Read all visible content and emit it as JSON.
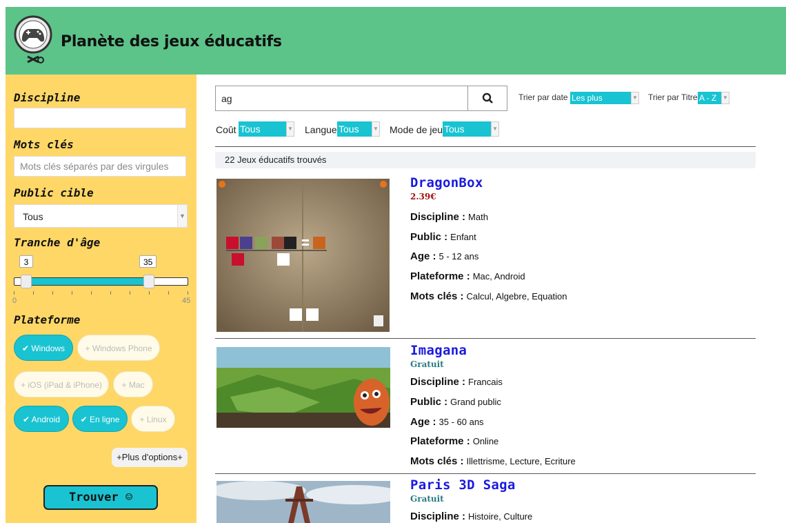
{
  "site": {
    "title": "Planète des jeux éducatifs"
  },
  "sidebar": {
    "discipline_label": "Discipline",
    "discipline_value": "",
    "keywords_label": "Mots clés",
    "keywords_placeholder": "Mots clés séparés par des virgules",
    "audience_label": "Public cible",
    "audience_value": "Tous",
    "age_label": "Tranche d'âge",
    "age_min_value": "3",
    "age_max_value": "35",
    "age_scale_min": "0",
    "age_scale_max": "45",
    "age_range": {
      "min": 3,
      "max": 35,
      "scale_min": 0,
      "scale_max": 45
    },
    "platform_label": "Plateforme",
    "platforms": [
      {
        "label": "Windows",
        "selected": true
      },
      {
        "label": "Windows Phone",
        "selected": false
      },
      {
        "label": "iOS (iPad & iPhone)",
        "selected": false
      },
      {
        "label": "Mac",
        "selected": false
      },
      {
        "label": "Android",
        "selected": true
      },
      {
        "label": "En ligne",
        "selected": true
      },
      {
        "label": "Linux",
        "selected": false
      }
    ],
    "more_options": "+Plus d'options+",
    "find_button": "Trouver ☺"
  },
  "search": {
    "query": "ag",
    "sort_date_label": "Trier par date",
    "sort_date_value": "Les plus récents",
    "sort_title_label": "Trier par Titre",
    "sort_title_value": "A - Z"
  },
  "filters": {
    "cost_label": "Coût",
    "cost_value": "Tous",
    "language_label": "Langue",
    "language_value": "Tous",
    "mode_label": "Mode de jeu",
    "mode_value": "Tous"
  },
  "results": {
    "count_text": "22 Jeux éducatifs trouvés",
    "attr_labels": {
      "discipline": "Discipline :",
      "public": "Public :",
      "age": "Age :",
      "platform": "Plateforme :",
      "keywords": "Mots clés :"
    },
    "games": [
      {
        "title": "DragonBox",
        "price": "2.39€",
        "discipline": "Math",
        "public": "Enfant",
        "age": "5 - 12 ans",
        "platform": "Mac, Android",
        "keywords": "Calcul, Algebre, Equation"
      },
      {
        "title": "Imagana",
        "price": "Gratuit",
        "discipline": "Francais",
        "public": "Grand public",
        "age": "35 - 60 ans",
        "platform": "Online",
        "keywords": "Illettrisme, Lecture, Ecriture"
      },
      {
        "title": "Paris 3D Saga",
        "price": "Gratuit",
        "discipline": "Histoire, Culture"
      }
    ]
  },
  "colors": {
    "header": "#5cc389",
    "sidebar": "#fed767",
    "accent": "#19c3d1",
    "title_link": "#1a1adf",
    "price_paid": "#a01010",
    "price_free": "#2a7a82"
  }
}
